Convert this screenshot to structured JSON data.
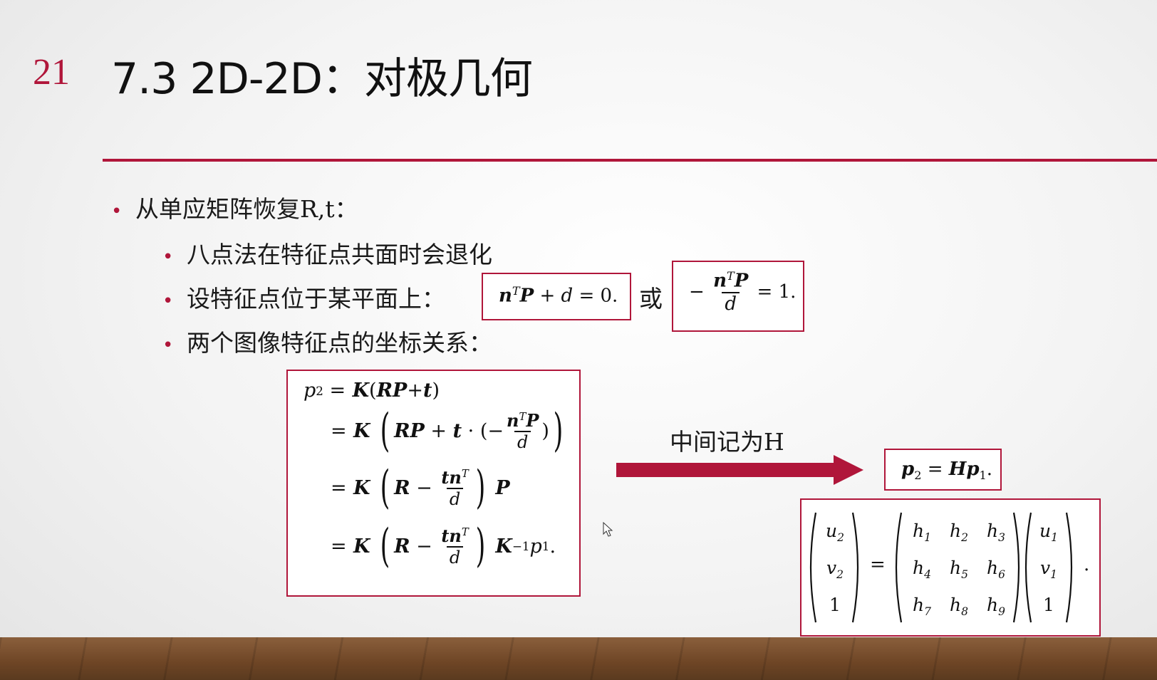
{
  "slide": {
    "number": "21",
    "title": "7.3 2D-2D：对极几何",
    "accent_color": "#b0163a"
  },
  "bullets": [
    {
      "level": 1,
      "text": "从单应矩阵恢复R,t："
    },
    {
      "level": 2,
      "text": "八点法在特征点共面时会退化"
    },
    {
      "level": 2,
      "text": "设特征点位于某平面上："
    },
    {
      "level": 2,
      "text": "两个图像特征点的坐标关系："
    }
  ],
  "equations": {
    "or_word": "或",
    "arrow_label": "中间记为H"
  }
}
